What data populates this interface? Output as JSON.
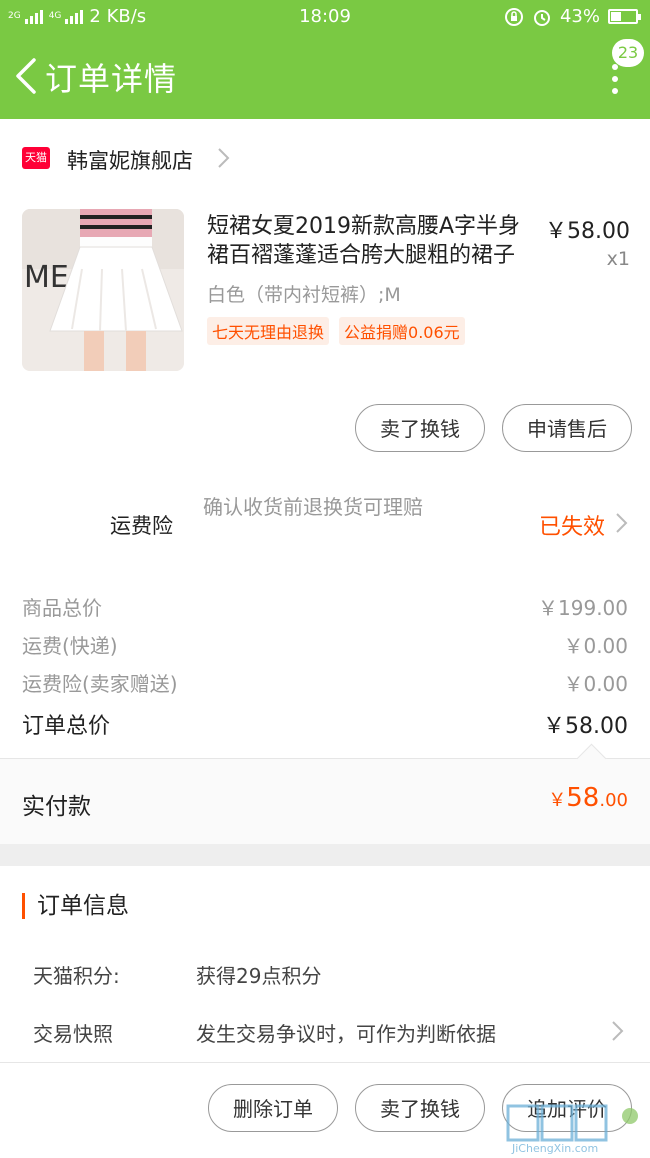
{
  "status_bar": {
    "network_1": "2G",
    "network_2": "4G",
    "speed": "2 KB/s",
    "time": "18:09",
    "battery": "43%",
    "battery_level": 0.43
  },
  "navbar": {
    "title": "订单详情",
    "badge": "23"
  },
  "store": {
    "logo_text": "天猫",
    "name": "韩富妮旗舰店"
  },
  "product": {
    "title_line1": "短裙女夏2019新款高腰A字半身",
    "title_line2": "裙百褶蓬蓬适合胯大腿粗的裙子",
    "price": "￥58.00",
    "qty": "x1",
    "sku": "白色（带内衬短裤）;M",
    "tags": [
      "七天无理由退换",
      "公益捐赠0.06元"
    ],
    "image_letters": "ME"
  },
  "item_actions": {
    "sell_label": "卖了换钱",
    "after_sale_label": "申请售后"
  },
  "insurance": {
    "label": "运费险",
    "desc": "确认收货前退换货可理赔",
    "status": "已失效"
  },
  "summary": {
    "rows": [
      {
        "label": "商品总价",
        "value": "￥199.00"
      },
      {
        "label": "运费(快递)",
        "value": "￥0.00"
      },
      {
        "label": "运费险(卖家赠送)",
        "value": "￥0.00"
      }
    ],
    "total_label": "订单总价",
    "total_value": "￥58.00"
  },
  "payment": {
    "label": "实付款",
    "currency": "￥",
    "int": "58",
    "dec": ".00"
  },
  "order_info": {
    "heading": "订单信息",
    "points_label": "天猫积分:",
    "points_value": "获得29点积分",
    "snapshot_label": "交易快照",
    "snapshot_value": "发生交易争议时，可作为判断依据"
  },
  "bottom_actions": {
    "delete_label": "删除订单",
    "sell_label": "卖了换钱",
    "review_label": "追加评价"
  },
  "watermark": {
    "text": "JiChengXin.com"
  },
  "colors": {
    "brand_green": "#7ac943",
    "accent_orange": "#ff5000",
    "tmall_red": "#ff0036"
  }
}
